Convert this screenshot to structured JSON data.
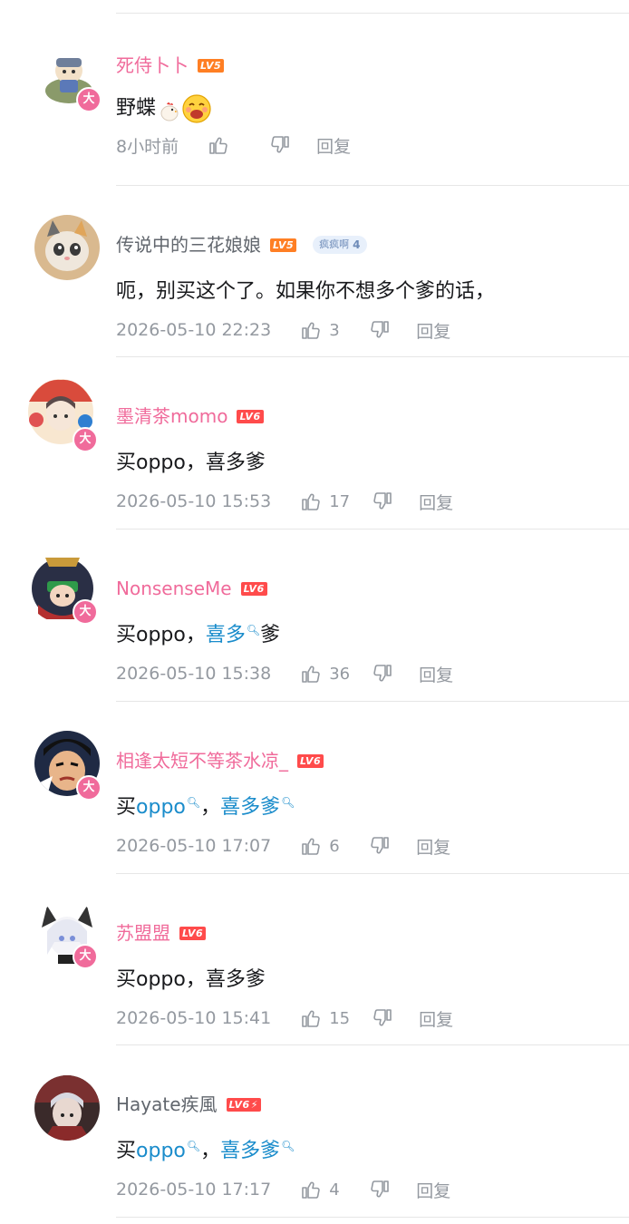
{
  "comments": [
    {
      "username": "死侍卜卜",
      "level": "LV5",
      "badge_char": "大",
      "text": "野蝶",
      "time": "8小时前",
      "likes": "",
      "reply_label": "回复",
      "emojis": [
        "chicken-emoji",
        "laughing-face-emoji"
      ]
    },
    {
      "username": "传说中的三花娘娘",
      "level": "LV5",
      "fan_label": "疯疯啊",
      "fan_level": "4",
      "text": "呃，别买这个了。如果你不想多个爹的话，",
      "time": "2026-05-10 22:23",
      "likes": "3",
      "reply_label": "回复"
    },
    {
      "username": "墨清茶momo",
      "level": "LV6",
      "badge_char": "大",
      "text": "买oppo，喜多爹",
      "time": "2026-05-10 15:53",
      "likes": "17",
      "reply_label": "回复"
    },
    {
      "username": "NonsenseMe",
      "level": "LV6",
      "badge_char": "大",
      "text_parts": [
        "买oppo，",
        "喜多",
        "爹"
      ],
      "time": "2026-05-10 15:38",
      "likes": "36",
      "reply_label": "回复"
    },
    {
      "username": "相逢太短不等茶水凉_",
      "level": "LV6",
      "badge_char": "大",
      "text_parts": [
        "买",
        "oppo",
        "，",
        "喜多爹"
      ],
      "time": "2026-05-10 17:07",
      "likes": "6",
      "reply_label": "回复"
    },
    {
      "username": "苏盟盟",
      "level": "LV6",
      "badge_char": "大",
      "text": "买oppo，喜多爹",
      "time": "2026-05-10 15:41",
      "likes": "15",
      "reply_label": "回复"
    },
    {
      "username": "Hayate疾風",
      "level": "LV6",
      "level_flash": "⚡",
      "text_parts": [
        "买",
        "oppo",
        "，",
        "喜多爹"
      ],
      "time": "2026-05-10 17:17",
      "likes": "4",
      "reply_label": "回复"
    }
  ],
  "colors": {
    "vip_name": "#f06b9b",
    "plain_name": "#61666d",
    "keyword_link": "#1a8ccb",
    "meta_text": "#9499a0",
    "lv5": "#ff7f24",
    "lv6": "#ff4b4b"
  }
}
